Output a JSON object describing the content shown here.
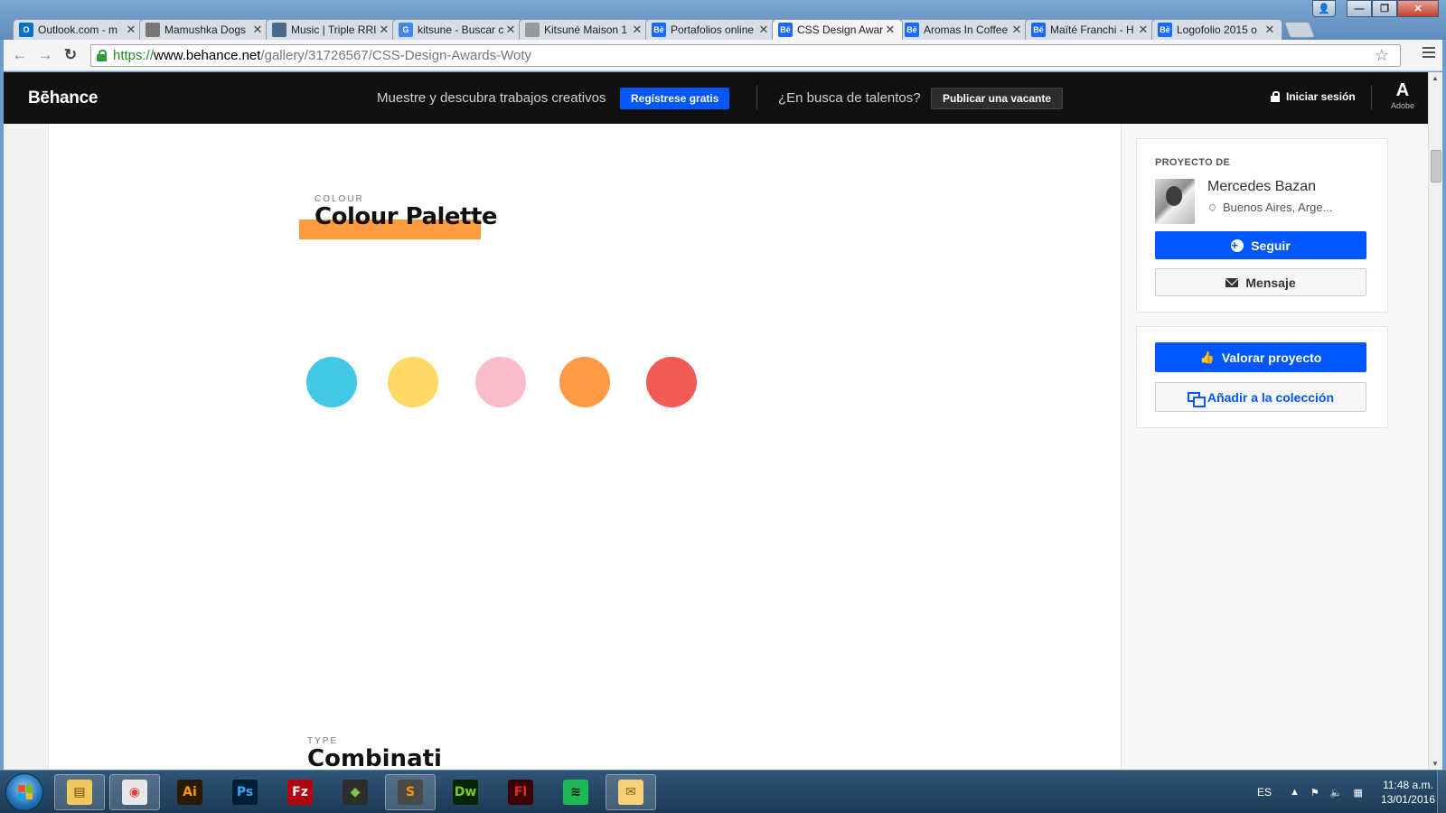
{
  "browser": {
    "tabs": [
      {
        "title": "Outlook.com - m",
        "favicon": "outlook-icon",
        "fav_text": "O",
        "fav_color": "#0072c6",
        "active": false
      },
      {
        "title": "Mamushka Dogs",
        "favicon": "page-icon",
        "fav_text": "",
        "fav_color": "#777777",
        "active": false
      },
      {
        "title": "Music | Triple RRI",
        "favicon": "music-icon",
        "fav_text": "",
        "fav_color": "#4a6a8a",
        "active": false
      },
      {
        "title": "kitsune - Buscar c",
        "favicon": "google-icon",
        "fav_text": "G",
        "fav_color": "#4285f4",
        "active": false
      },
      {
        "title": "Kitsuné Maison 1",
        "favicon": "page-icon",
        "fav_text": "",
        "fav_color": "#999999",
        "active": false
      },
      {
        "title": "Portafolios online",
        "favicon": "behance-icon",
        "fav_text": "Bē",
        "fav_color": "#1769ff",
        "active": false
      },
      {
        "title": "CSS Design Awar",
        "favicon": "behance-icon",
        "fav_text": "Bē",
        "fav_color": "#1769ff",
        "active": true
      },
      {
        "title": "Aromas In Coffee",
        "favicon": "behance-icon",
        "fav_text": "Bē",
        "fav_color": "#1769ff",
        "active": false
      },
      {
        "title": "Maïté Franchi - H",
        "favicon": "behance-icon",
        "fav_text": "Bē",
        "fav_color": "#1769ff",
        "active": false
      },
      {
        "title": "Logofolio 2015 o",
        "favicon": "behance-icon",
        "fav_text": "Bē",
        "fav_color": "#1769ff",
        "active": false
      }
    ],
    "url": {
      "scheme": "https://",
      "host": "www.behance.net",
      "path": "/gallery/31726567/CSS-Design-Awards-Woty"
    }
  },
  "header": {
    "logo": "Bēhance",
    "tagline": "Muestre y descubra trabajos creativos",
    "register_label": "Regístrese gratis",
    "talent_text": "¿En busca de talentos?",
    "post_job_label": "Publicar una vacante",
    "login_label": "Iniciar sesión",
    "adobe_label": "Adobe"
  },
  "project": {
    "section_eyebrow": "COLOUR",
    "section_title": "Colour Palette",
    "highlight_color": "#ff9a3e",
    "swatches": [
      {
        "name": "cyan-swatch",
        "color": "#42c8e6"
      },
      {
        "name": "yellow-swatch",
        "color": "#ffd966"
      },
      {
        "name": "pink-swatch",
        "color": "#f9bcc9"
      },
      {
        "name": "orange-swatch",
        "color": "#ff9a46"
      },
      {
        "name": "red-swatch",
        "color": "#f25a55"
      }
    ],
    "next_eyebrow": "TYPE",
    "next_title": "Combinati"
  },
  "sidebar": {
    "owner_label": "PROYECTO DE",
    "owner_name": "Mercedes Bazan",
    "owner_location": "Buenos Aires, Arge...",
    "follow_label": "Seguir",
    "message_label": "Mensaje",
    "appreciate_label": "Valorar proyecto",
    "collection_label": "Añadir a la colección"
  },
  "taskbar": {
    "apps": [
      {
        "name": "explorer",
        "glyph": "▤",
        "bg": "#f2c75c",
        "fg": "#6b4a00"
      },
      {
        "name": "chrome",
        "glyph": "◉",
        "bg": "#e8e8e8",
        "fg": "#db4437"
      },
      {
        "name": "illustrator",
        "glyph": "Ai",
        "bg": "#2a1a00",
        "fg": "#ff9a00"
      },
      {
        "name": "photoshop",
        "glyph": "Ps",
        "bg": "#001d34",
        "fg": "#31a8ff"
      },
      {
        "name": "filezilla",
        "glyph": "Fz",
        "bg": "#b2000d",
        "fg": "#ffffff"
      },
      {
        "name": "sketchup",
        "glyph": "◆",
        "bg": "#2d2d2d",
        "fg": "#7ac943"
      },
      {
        "name": "sublime",
        "glyph": "S",
        "bg": "#4a4a4a",
        "fg": "#ff9800"
      },
      {
        "name": "dreamweaver",
        "glyph": "Dw",
        "bg": "#072401",
        "fg": "#7ecb20"
      },
      {
        "name": "flash",
        "glyph": "Fl",
        "bg": "#3d0000",
        "fg": "#e12b2b"
      },
      {
        "name": "spotify",
        "glyph": "≋",
        "bg": "#1db954",
        "fg": "#111111"
      },
      {
        "name": "outlook",
        "glyph": "✉",
        "bg": "#f5d27a",
        "fg": "#8a5a00"
      }
    ],
    "language": "ES",
    "time": "11:48 a.m.",
    "date": "13/01/2016"
  }
}
